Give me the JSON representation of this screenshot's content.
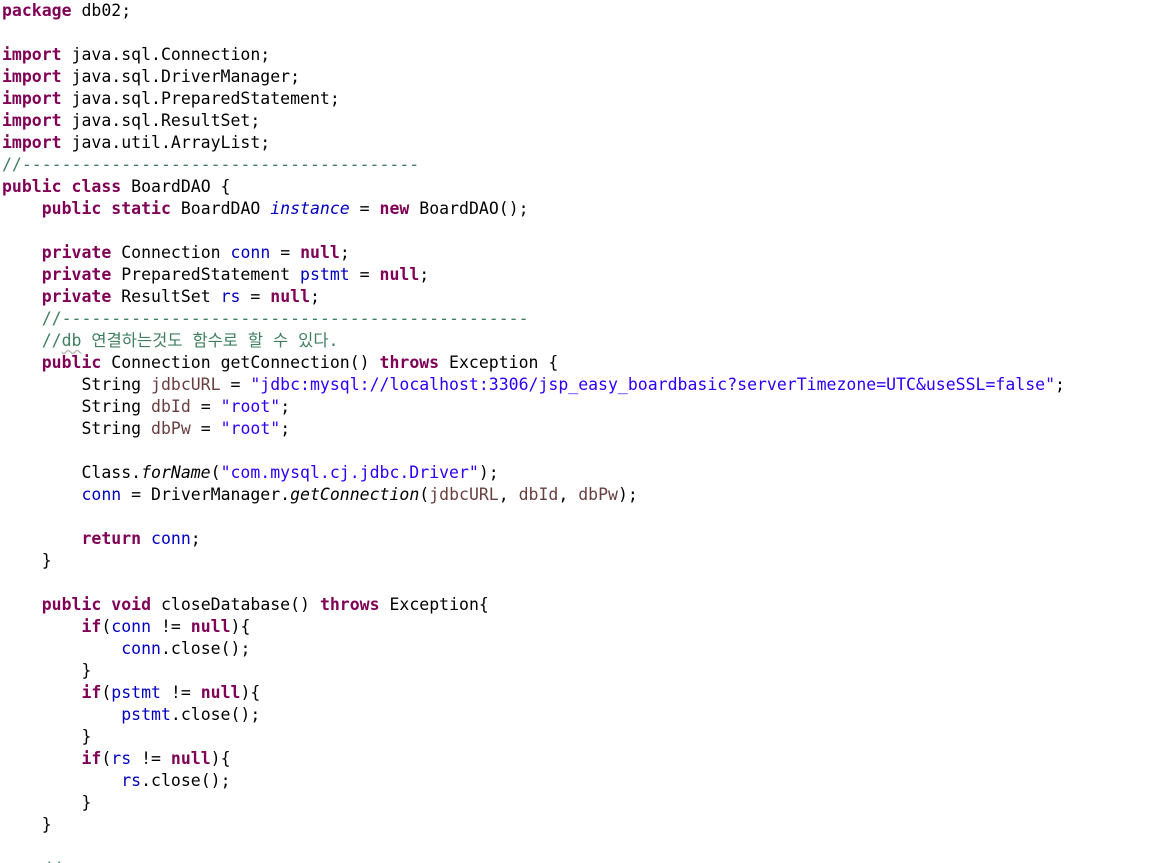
{
  "editor": {
    "language": "java",
    "colors": {
      "keyword": "#7f0055",
      "comment": "#3f7f5f",
      "string": "#2a00ff",
      "field": "#0000c0",
      "local_variable": "#6a3e3e",
      "plain": "#000000",
      "background": "#ffffff"
    },
    "lines": [
      [
        {
          "t": "kw",
          "v": "package"
        },
        {
          "t": "pln",
          "v": " db02;"
        }
      ],
      [],
      [
        {
          "t": "kw",
          "v": "import"
        },
        {
          "t": "pln",
          "v": " java.sql.Connection;"
        }
      ],
      [
        {
          "t": "kw",
          "v": "import"
        },
        {
          "t": "pln",
          "v": " java.sql.DriverManager;"
        }
      ],
      [
        {
          "t": "kw",
          "v": "import"
        },
        {
          "t": "pln",
          "v": " java.sql.PreparedStatement;"
        }
      ],
      [
        {
          "t": "kw",
          "v": "import"
        },
        {
          "t": "pln",
          "v": " java.sql.ResultSet;"
        }
      ],
      [
        {
          "t": "kw",
          "v": "import"
        },
        {
          "t": "pln",
          "v": " java.util.ArrayList;"
        }
      ],
      [
        {
          "t": "cm",
          "v": "//----------------------------------------"
        }
      ],
      [
        {
          "t": "kw",
          "v": "public"
        },
        {
          "t": "pln",
          "v": " "
        },
        {
          "t": "kw",
          "v": "class"
        },
        {
          "t": "pln",
          "v": " BoardDAO {"
        }
      ],
      [
        {
          "t": "pln",
          "v": "    "
        },
        {
          "t": "kw",
          "v": "public"
        },
        {
          "t": "pln",
          "v": " "
        },
        {
          "t": "kw",
          "v": "static"
        },
        {
          "t": "pln",
          "v": " BoardDAO "
        },
        {
          "t": "sfld",
          "v": "instance"
        },
        {
          "t": "pln",
          "v": " = "
        },
        {
          "t": "kw",
          "v": "new"
        },
        {
          "t": "pln",
          "v": " BoardDAO();"
        }
      ],
      [],
      [
        {
          "t": "pln",
          "v": "    "
        },
        {
          "t": "kw",
          "v": "private"
        },
        {
          "t": "pln",
          "v": " Connection "
        },
        {
          "t": "fld",
          "v": "conn"
        },
        {
          "t": "pln",
          "v": " = "
        },
        {
          "t": "kw",
          "v": "null"
        },
        {
          "t": "pln",
          "v": ";"
        }
      ],
      [
        {
          "t": "pln",
          "v": "    "
        },
        {
          "t": "kw",
          "v": "private"
        },
        {
          "t": "pln",
          "v": " PreparedStatement "
        },
        {
          "t": "fld",
          "v": "pstmt"
        },
        {
          "t": "pln",
          "v": " = "
        },
        {
          "t": "kw",
          "v": "null"
        },
        {
          "t": "pln",
          "v": ";"
        }
      ],
      [
        {
          "t": "pln",
          "v": "    "
        },
        {
          "t": "kw",
          "v": "private"
        },
        {
          "t": "pln",
          "v": " ResultSet "
        },
        {
          "t": "fld",
          "v": "rs"
        },
        {
          "t": "pln",
          "v": " = "
        },
        {
          "t": "kw",
          "v": "null"
        },
        {
          "t": "pln",
          "v": ";"
        }
      ],
      [
        {
          "t": "pln",
          "v": "    "
        },
        {
          "t": "cm",
          "v": "//-----------------------------------------------"
        }
      ],
      [
        {
          "t": "pln",
          "v": "    "
        },
        {
          "t": "cm",
          "v": "//"
        },
        {
          "t": "cm spell",
          "v": "db"
        },
        {
          "t": "cm",
          "v": " 연결하는것도 함수로 할 수 있다."
        }
      ],
      [
        {
          "t": "pln",
          "v": "    "
        },
        {
          "t": "kw",
          "v": "public"
        },
        {
          "t": "pln",
          "v": " Connection getConnection() "
        },
        {
          "t": "kw",
          "v": "throws"
        },
        {
          "t": "pln",
          "v": " Exception {"
        }
      ],
      [
        {
          "t": "pln",
          "v": "        String "
        },
        {
          "t": "var",
          "v": "jdbcURL"
        },
        {
          "t": "pln",
          "v": " = "
        },
        {
          "t": "str",
          "v": "\"jdbc:mysql://localhost:3306/jsp_easy_boardbasic?serverTimezone=UTC&useSSL=false\""
        },
        {
          "t": "pln",
          "v": ";"
        }
      ],
      [
        {
          "t": "pln",
          "v": "        String "
        },
        {
          "t": "var",
          "v": "dbId"
        },
        {
          "t": "pln",
          "v": " = "
        },
        {
          "t": "str",
          "v": "\"root\""
        },
        {
          "t": "pln",
          "v": ";"
        }
      ],
      [
        {
          "t": "pln",
          "v": "        String "
        },
        {
          "t": "var",
          "v": "dbPw"
        },
        {
          "t": "pln",
          "v": " = "
        },
        {
          "t": "str",
          "v": "\"root\""
        },
        {
          "t": "pln",
          "v": ";"
        }
      ],
      [],
      [
        {
          "t": "pln",
          "v": "        Class."
        },
        {
          "t": "smth",
          "v": "forName"
        },
        {
          "t": "pln",
          "v": "("
        },
        {
          "t": "str",
          "v": "\"com.mysql.cj.jdbc.Driver\""
        },
        {
          "t": "pln",
          "v": ");"
        }
      ],
      [
        {
          "t": "pln",
          "v": "        "
        },
        {
          "t": "fld",
          "v": "conn"
        },
        {
          "t": "pln",
          "v": " = DriverManager."
        },
        {
          "t": "smth",
          "v": "getConnection"
        },
        {
          "t": "pln",
          "v": "("
        },
        {
          "t": "var",
          "v": "jdbcURL"
        },
        {
          "t": "pln",
          "v": ", "
        },
        {
          "t": "var",
          "v": "dbId"
        },
        {
          "t": "pln",
          "v": ", "
        },
        {
          "t": "var",
          "v": "dbPw"
        },
        {
          "t": "pln",
          "v": ");"
        }
      ],
      [],
      [
        {
          "t": "pln",
          "v": "        "
        },
        {
          "t": "kw",
          "v": "return"
        },
        {
          "t": "pln",
          "v": " "
        },
        {
          "t": "fld",
          "v": "conn"
        },
        {
          "t": "pln",
          "v": ";"
        }
      ],
      [
        {
          "t": "pln",
          "v": "    }"
        }
      ],
      [],
      [
        {
          "t": "pln",
          "v": "    "
        },
        {
          "t": "kw",
          "v": "public"
        },
        {
          "t": "pln",
          "v": " "
        },
        {
          "t": "kw",
          "v": "void"
        },
        {
          "t": "pln",
          "v": " closeDatabase() "
        },
        {
          "t": "kw",
          "v": "throws"
        },
        {
          "t": "pln",
          "v": " Exception{"
        }
      ],
      [
        {
          "t": "pln",
          "v": "        "
        },
        {
          "t": "kw",
          "v": "if"
        },
        {
          "t": "pln",
          "v": "("
        },
        {
          "t": "fld",
          "v": "conn"
        },
        {
          "t": "pln",
          "v": " != "
        },
        {
          "t": "kw",
          "v": "null"
        },
        {
          "t": "pln",
          "v": "){"
        }
      ],
      [
        {
          "t": "pln",
          "v": "            "
        },
        {
          "t": "fld",
          "v": "conn"
        },
        {
          "t": "pln",
          "v": ".close();"
        }
      ],
      [
        {
          "t": "pln",
          "v": "        }"
        }
      ],
      [
        {
          "t": "pln",
          "v": "        "
        },
        {
          "t": "kw",
          "v": "if"
        },
        {
          "t": "pln",
          "v": "("
        },
        {
          "t": "fld",
          "v": "pstmt"
        },
        {
          "t": "pln",
          "v": " != "
        },
        {
          "t": "kw",
          "v": "null"
        },
        {
          "t": "pln",
          "v": "){"
        }
      ],
      [
        {
          "t": "pln",
          "v": "            "
        },
        {
          "t": "fld",
          "v": "pstmt"
        },
        {
          "t": "pln",
          "v": ".close();"
        }
      ],
      [
        {
          "t": "pln",
          "v": "        }"
        }
      ],
      [
        {
          "t": "pln",
          "v": "        "
        },
        {
          "t": "kw",
          "v": "if"
        },
        {
          "t": "pln",
          "v": "("
        },
        {
          "t": "fld",
          "v": "rs"
        },
        {
          "t": "pln",
          "v": " != "
        },
        {
          "t": "kw",
          "v": "null"
        },
        {
          "t": "pln",
          "v": "){"
        }
      ],
      [
        {
          "t": "pln",
          "v": "            "
        },
        {
          "t": "fld",
          "v": "rs"
        },
        {
          "t": "pln",
          "v": ".close();"
        }
      ],
      [
        {
          "t": "pln",
          "v": "        }"
        }
      ],
      [
        {
          "t": "pln",
          "v": "    }"
        }
      ],
      [],
      [
        {
          "t": "pln",
          "v": "    "
        },
        {
          "t": "cm",
          "v": "//"
        }
      ]
    ]
  }
}
